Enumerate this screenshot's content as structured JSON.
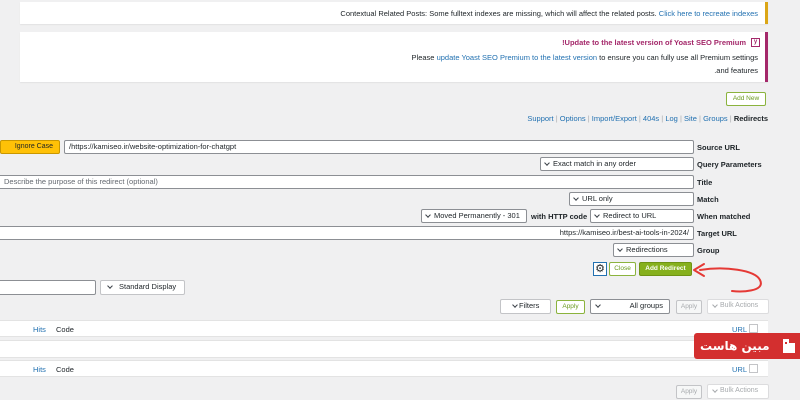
{
  "notices": {
    "contextual": {
      "text": "Contextual Related Posts: Some fulltext indexes are missing, which will affect the related posts.",
      "link": "Click here to recreate indexes"
    },
    "yoast": {
      "title": "!Update to the latest version of Yoast SEO Premium",
      "please": "Please",
      "link": "update Yoast SEO Premium to the latest version",
      "rest": "to ensure you can fully use all Premium settings",
      "line2": ".and features",
      "icon": "yoast-logo"
    }
  },
  "header": {
    "add_new": "Add New"
  },
  "subnav": {
    "items": [
      "Support",
      "Options",
      "Import/Export",
      "404s",
      "Log",
      "Site",
      "Groups"
    ],
    "current": "Redirects",
    "sep": "|"
  },
  "form": {
    "ignore_case": "Ignore Case",
    "source_url": "https://kamiseo.ir/website-optimization-for-chatgpt/",
    "source_url_label": "Source URL",
    "query_value": "Exact match in any order",
    "query_label": "Query Parameters",
    "title_placeholder": "Describe the purpose of this redirect (optional)",
    "title_label": "Title",
    "match_value": "URL only",
    "match_label": "Match",
    "status_value": "Moved Permanently - 301",
    "http_code_label": "with HTTP code",
    "action_value": "Redirect to URL",
    "when_label": "When matched",
    "target_url": "https://kamiseo.ir/best-ai-tools-in-2024/",
    "target_label": "Target URL",
    "group_value": "Redirections",
    "group_label": "Group",
    "close": "Close",
    "add_redirect": "Add Redirect",
    "gear_icon": "gear-icon"
  },
  "toolbar1": {
    "display": "Standard Display"
  },
  "toolbar2": {
    "filters": "Filters",
    "apply": "Apply",
    "groups": "All groups",
    "bulk": "Bulk Actions"
  },
  "table": {
    "columns": {
      "hits": "Hits",
      "code": "Code",
      "url": "URL"
    }
  },
  "watermark": {
    "text": "مبین هاست",
    "brand_color": "#d32f2f"
  },
  "annotation_color": "#e53935"
}
